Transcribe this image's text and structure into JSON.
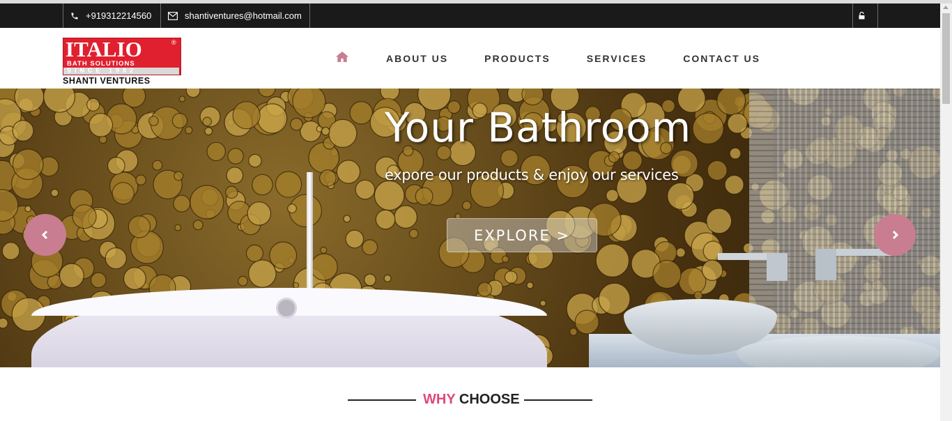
{
  "topbar": {
    "phone": "+919312214560",
    "email": "shantiventures@hotmail.com",
    "icons": {
      "phone": "phone-icon",
      "email": "envelope-icon",
      "lock": "lock-icon"
    }
  },
  "logo": {
    "brand": "ITALIO",
    "registered": "®",
    "tagline": "BATH SOLUTIONS",
    "since": "SINCE 1982",
    "company": "SHANTI VENTURES"
  },
  "nav": {
    "home_icon": "home-icon",
    "items": [
      "ABOUT US",
      "PRODUCTS",
      "SERVICES",
      "CONTACT US"
    ]
  },
  "hero": {
    "title": "Your Bathroom",
    "subtitle": "expore our products & enjoy our services",
    "button": "EXPLORE >",
    "prev_icon": "chevron-left-icon",
    "next_icon": "chevron-right-icon"
  },
  "why": {
    "highlight": "WHY",
    "rest": "CHOOSE"
  },
  "colors": {
    "accent_pink": "#e0497a",
    "arrow_bg": "#c97d91",
    "topbar_bg": "#1a1a1a",
    "logo_red": "#e0202f"
  }
}
